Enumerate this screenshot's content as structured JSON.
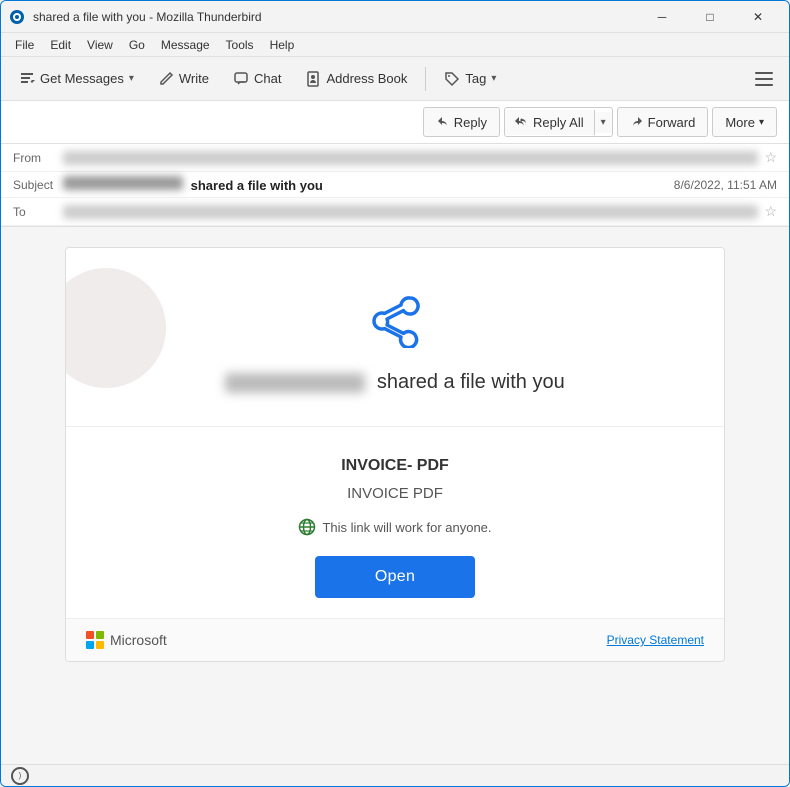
{
  "window": {
    "title": "shared a file with you - Mozilla Thunderbird",
    "icon": "thunderbird"
  },
  "titlebar": {
    "minimize_label": "─",
    "maximize_label": "□",
    "close_label": "✕"
  },
  "menubar": {
    "items": [
      "File",
      "Edit",
      "View",
      "Go",
      "Message",
      "Tools",
      "Help"
    ]
  },
  "toolbar": {
    "get_messages_label": "Get Messages",
    "write_label": "Write",
    "chat_label": "Chat",
    "address_book_label": "Address Book",
    "tag_label": "Tag"
  },
  "email": {
    "from_label": "From",
    "from_value_blurred": true,
    "subject_label": "Subject",
    "subject_prefix_blurred": true,
    "subject_text": "shared a file with you",
    "to_label": "To",
    "to_value_blurred": true,
    "date": "8/6/2022, 11:51 AM",
    "actions": {
      "reply_label": "Reply",
      "reply_all_label": "Reply All",
      "forward_label": "Forward",
      "more_label": "More"
    }
  },
  "card": {
    "sender_blurred": true,
    "share_text": "shared a file with you",
    "invoice_title": "INVOICE- PDF",
    "invoice_subtitle": "INVOICE PDF",
    "link_notice": "This link will work for anyone.",
    "open_btn_label": "Open"
  },
  "footer": {
    "brand_label": "Microsoft",
    "privacy_label": "Privacy Statement"
  },
  "statusbar": {
    "icon": "signal"
  }
}
